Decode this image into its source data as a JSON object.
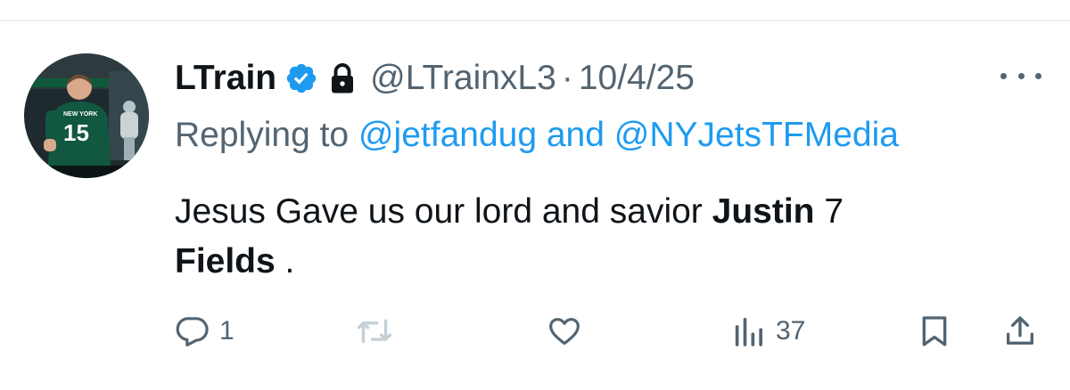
{
  "author": {
    "display_name": "LTrain",
    "handle": "@LTrainxL3",
    "separator": "·",
    "date": "10/4/25",
    "avatar_jersey_number": "15",
    "avatar_jersey_text": "NEW YORK"
  },
  "reply": {
    "prefix": "Replying to ",
    "mention_1": "@jetfandug",
    "joiner": " and ",
    "mention_2": "@NYJetsTFMedia"
  },
  "body": {
    "part_1": "Jesus Gave us our lord and savior ",
    "bold_1": "Justin",
    "part_2": " 7",
    "bold_2": "Fields",
    "part_3": " ."
  },
  "actions": {
    "reply_count": "1",
    "retweet_count": "",
    "like_count": "",
    "views_count": "37",
    "icons": [
      "reply-icon",
      "retweet-icon",
      "like-icon",
      "views-icon",
      "bookmark-icon",
      "share-icon"
    ]
  },
  "colors": {
    "text": "#0f1419",
    "secondary": "#536471",
    "link": "#1d9bf0",
    "retweet_icon": "#c4cfd6",
    "jets_green": "#125740"
  }
}
